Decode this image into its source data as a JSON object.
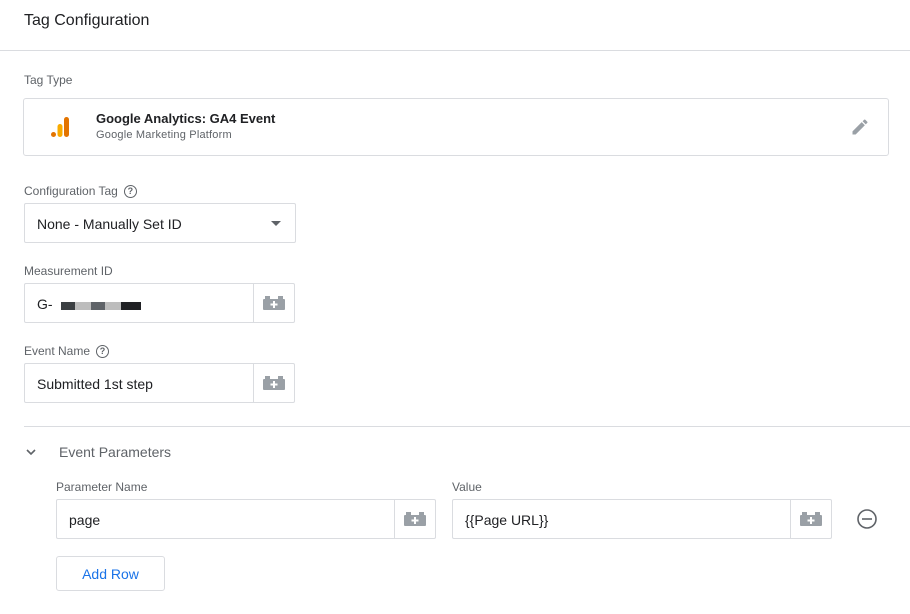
{
  "header": {
    "title": "Tag Configuration"
  },
  "tag_type": {
    "label": "Tag Type",
    "name": "Google Analytics: GA4 Event",
    "platform": "Google Marketing Platform",
    "logo_icon": "google-analytics-icon",
    "edit_icon": "pencil-icon",
    "logo_colors": [
      "#e37400",
      "#f9ab00"
    ]
  },
  "configuration_tag": {
    "label": "Configuration Tag",
    "help_glyph": "?",
    "value": "None - Manually Set ID"
  },
  "measurement_id": {
    "label": "Measurement ID",
    "value_prefix": "G-",
    "value_redacted": true,
    "variable_icon": "variable-picker-icon"
  },
  "event_name": {
    "label": "Event Name",
    "help_glyph": "?",
    "value": "Submitted 1st step"
  },
  "event_parameters": {
    "title": "Event Parameters",
    "expanded": true,
    "name_header": "Parameter Name",
    "value_header": "Value",
    "rows": [
      {
        "name": "page",
        "value": "{{Page URL}}"
      }
    ],
    "add_row_label": "Add Row"
  },
  "colors": {
    "accent": "#1a73e8",
    "border": "#dadce0",
    "muted_text": "#5f6368"
  }
}
